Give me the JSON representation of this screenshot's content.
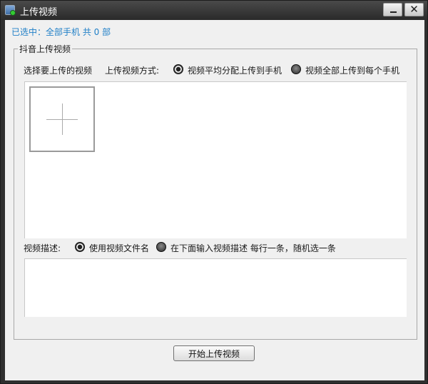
{
  "window": {
    "title": "上传视频",
    "close_glyph": "✕"
  },
  "status": {
    "selected_text": "已选中：全部手机 共 0 部"
  },
  "group": {
    "title": "抖音上传视频",
    "select_label": "选择要上传的视频",
    "mode_label": "上传视频方式:",
    "mode_options": [
      {
        "label": "视频平均分配上传到手机",
        "selected": true
      },
      {
        "label": "视频全部上传到每个手机",
        "selected": false
      }
    ],
    "desc_label": "视频描述:",
    "desc_options": [
      {
        "label": "使用视频文件名",
        "selected": true
      },
      {
        "label": "在下面输入视频描述 每行一条，随机选一条",
        "selected": false
      }
    ],
    "desc_value": ""
  },
  "actions": {
    "start_label": "开始上传视频"
  }
}
